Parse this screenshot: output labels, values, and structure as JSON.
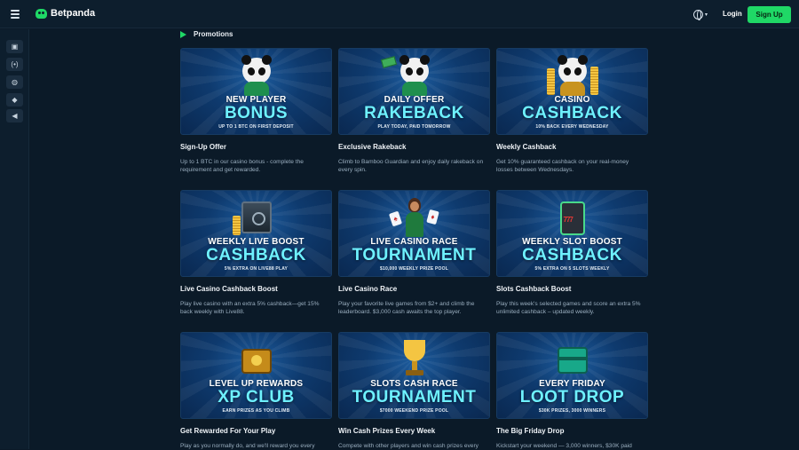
{
  "header": {
    "logo_text": "Betpanda",
    "login_label": "Login",
    "signup_label": "Sign Up"
  },
  "sidebar": {
    "icons": [
      "casino-icon",
      "live-icon",
      "sports-icon",
      "games-icon",
      "promotions-icon"
    ]
  },
  "section": {
    "title": "Promotions"
  },
  "colors": {
    "accent": "#1fd866",
    "background": "#0b1a28",
    "banner_highlight": "#6ef1ff"
  },
  "cards": [
    {
      "banner_top": "NEW PLAYER",
      "banner_big": "BONUS",
      "banner_small": "UP TO 1 BTC ON FIRST DEPOSIT",
      "title": "Sign-Up Offer",
      "desc": "Up to 1 BTC in our casino bonus - complete the requirement and get rewarded."
    },
    {
      "banner_top": "DAILY OFFER",
      "banner_big": "RAKEBACK",
      "banner_small": "PLAY TODAY, PAID TOMORROW",
      "title": "Exclusive Rakeback",
      "desc": "Climb to Bamboo Guardian and enjoy daily rakeback on every spin."
    },
    {
      "banner_top": "CASINO",
      "banner_big": "CASHBACK",
      "banner_small": "10% BACK EVERY WEDNESDAY",
      "title": "Weekly Cashback",
      "desc": "Get 10% guaranteed cashback on your real-money losses between Wednesdays."
    },
    {
      "banner_top": "WEEKLY LIVE BOOST",
      "banner_big": "CASHBACK",
      "banner_small": "5% EXTRA ON LIVE88 PLAY",
      "title": "Live Casino Cashback Boost",
      "desc": "Play live casino with an extra 5% cashback—get 15% back weekly with Live88."
    },
    {
      "banner_top": "LIVE CASINO RACE",
      "banner_big": "TOURNAMENT",
      "banner_small": "$10,000 WEEKLY PRIZE POOL",
      "title": "Live Casino Race",
      "desc": "Play your favorite live games from $2+ and climb the leaderboard. $3,000 cash awaits the top player."
    },
    {
      "banner_top": "WEEKLY SLOT BOOST",
      "banner_big": "CASHBACK",
      "banner_small": "5% EXTRA ON 5 SLOTS WEEKLY",
      "title": "Slots Cashback Boost",
      "desc": "Play this week's selected games and score an extra 5% unlimited cashback – updated weekly."
    },
    {
      "banner_top": "LEVEL UP REWARDS",
      "banner_big": "XP CLUB",
      "banner_small": "EARN PRIZES AS YOU CLIMB",
      "title": "Get Rewarded For Your Play",
      "desc": "Play as you normally do, and we'll reward you every"
    },
    {
      "banner_top": "SLOTS CASH RACE",
      "banner_big": "TOURNAMENT",
      "banner_small": "$7000 WEEKEND PRIZE POOL",
      "title": "Win Cash Prizes Every Week",
      "desc": "Compete with other players and win cash prizes every"
    },
    {
      "banner_top": "EVERY FRIDAY",
      "banner_big": "LOOT DROP",
      "banner_small": "$30K PRIZES, 3000 WINNERS",
      "title": "The Big Friday Drop",
      "desc": "Kickstart your weekend — 3,000 winners, $30K paid"
    }
  ]
}
